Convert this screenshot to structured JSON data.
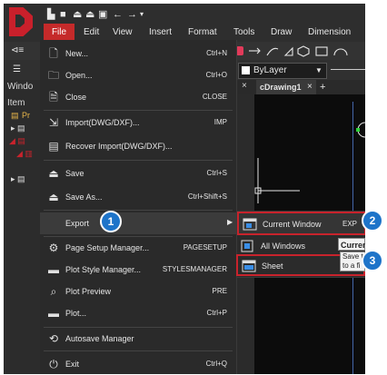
{
  "quick_access": [
    "▙",
    "■",
    "⏏",
    "⏏",
    "▣",
    "←",
    "→",
    "▾"
  ],
  "menubar": {
    "file": "File",
    "items": [
      "Edit",
      "View",
      "Insert",
      "Format",
      "Tools",
      "Draw",
      "Dimension"
    ]
  },
  "left_panel": {
    "window_label": "Windo",
    "item_label": "Item",
    "pr": "Pr"
  },
  "layer": {
    "value": "ByLayer"
  },
  "drawing_tab": {
    "label": "cDrawing1",
    "close": "×",
    "add": "+",
    "x": "×"
  },
  "file_menu": [
    {
      "icon": "new-file",
      "label": "New...",
      "shortcut": "Ctrl+N"
    },
    {
      "icon": "open-folder",
      "label": "Open...",
      "shortcut": "Ctrl+O"
    },
    {
      "icon": "close-document",
      "label": "Close",
      "shortcut": "CLOSE"
    },
    {
      "icon": "import",
      "label": "Import(DWG/DXF)...",
      "shortcut": "IMP"
    },
    {
      "icon": "recover-import",
      "label": "Recover Import(DWG/DXF)...",
      "shortcut": ""
    },
    {
      "icon": "save",
      "label": "Save",
      "shortcut": "Ctrl+S"
    },
    {
      "icon": "save-as",
      "label": "Save As...",
      "shortcut": "Ctrl+Shift+S"
    },
    {
      "icon": "",
      "label": "Export",
      "shortcut": ""
    },
    {
      "icon": "page-setup",
      "label": "Page Setup Manager...",
      "shortcut": "PAGESETUP"
    },
    {
      "icon": "plot-style",
      "label": "Plot Style Manager...",
      "shortcut": "STYLESMANAGER"
    },
    {
      "icon": "plot-preview",
      "label": "Plot Preview",
      "shortcut": "PRE"
    },
    {
      "icon": "plot",
      "label": "Plot...",
      "shortcut": "Ctrl+P"
    },
    {
      "icon": "autosave",
      "label": "Autosave Manager",
      "shortcut": ""
    },
    {
      "icon": "power",
      "label": "Exit",
      "shortcut": "Ctrl+Q"
    }
  ],
  "export_submenu": [
    {
      "label": "Current Window",
      "shortcut": "EXP"
    },
    {
      "label": "All Windows",
      "shortcut": ""
    },
    {
      "label": "Sheet",
      "shortcut": ""
    }
  ],
  "tooltip": {
    "line1": "Curren",
    "line2": "Save t",
    "line3": "to a fi"
  },
  "badges": [
    "1",
    "2",
    "3"
  ],
  "colors": {
    "accent": "#c52a2a",
    "badge": "#1e74c9",
    "highlight": "#c8232c"
  }
}
